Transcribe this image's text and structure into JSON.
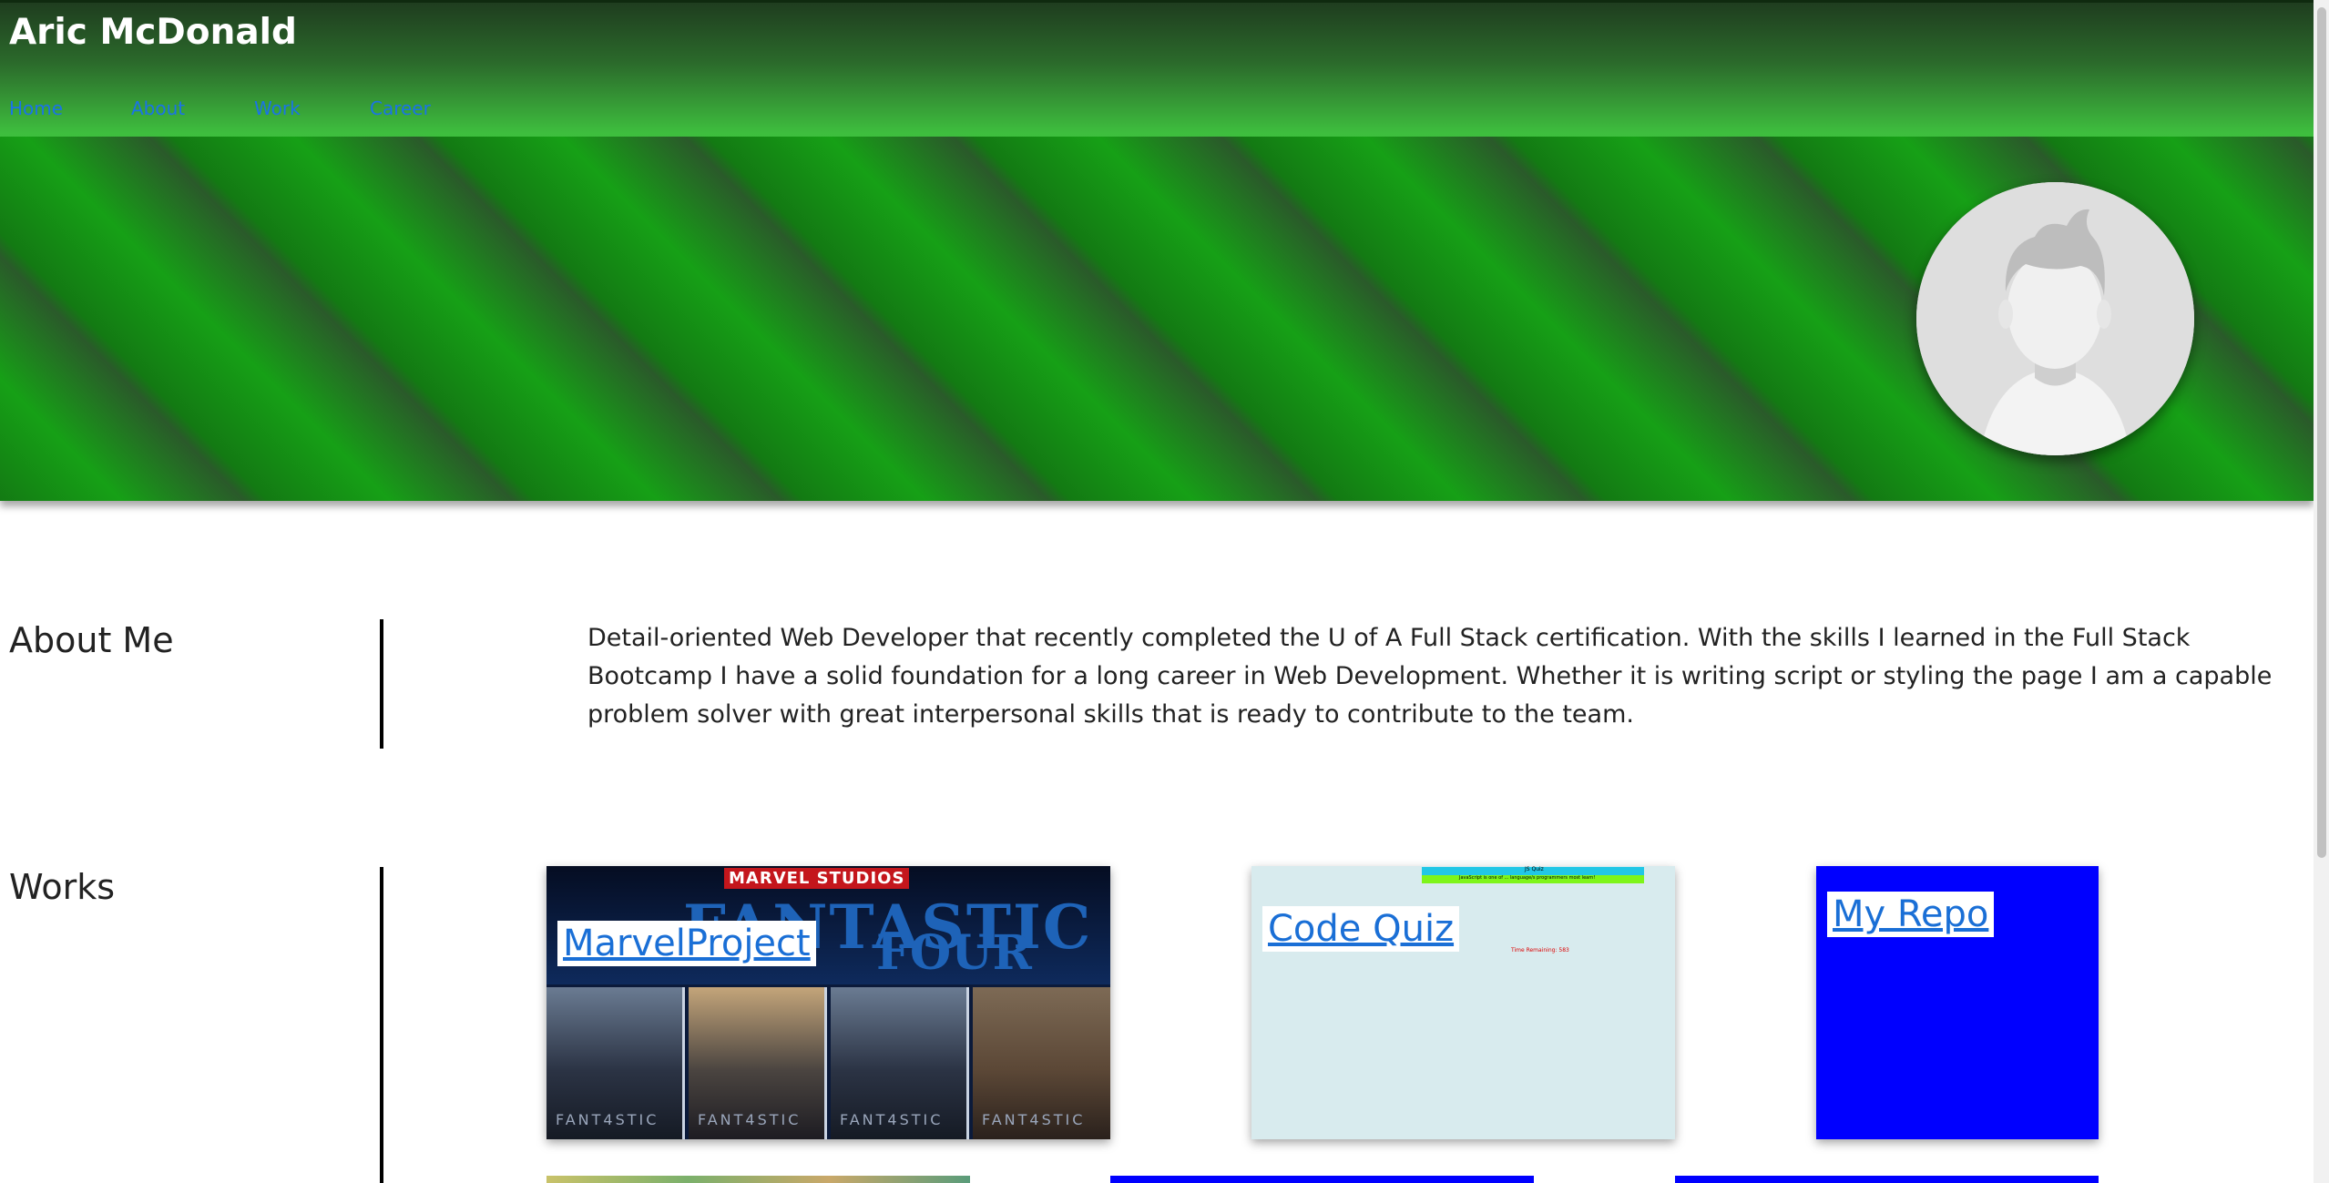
{
  "header": {
    "title": "Aric McDonald",
    "nav": [
      "Home",
      "About",
      "Work",
      "Career"
    ]
  },
  "about": {
    "heading": "About Me",
    "text": "Detail-oriented Web Developer that recently completed the U of A Full Stack certification. With the skills I learned in the Full Stack Bootcamp I have a solid foundation for a long career in Web Development. Whether it is writing script or styling the page I am a capable problem solver with great interpersonal skills that is ready to contribute to the team."
  },
  "works": {
    "heading": "Works",
    "cards": [
      {
        "label": "MarvelProject",
        "brand": "MARVEL STUDIOS",
        "poster_line1": "FANTASTIC",
        "poster_line2": "FOUR",
        "panel_glyph": "FANT4STIC"
      },
      {
        "label": "Code Quiz",
        "tiny_title": "JS Quiz",
        "tiny_question": "JavaScript is one of ... language/s programmers most learn!",
        "tiny_time": "Time Remaining: 583"
      },
      {
        "label": "My Repo"
      }
    ]
  },
  "colors": {
    "header_top": "#1f3d1f",
    "header_bottom": "#3fc23f",
    "nav_link": "#1a73e8",
    "banner_green": "#16a016",
    "repo_blue": "#0000ff",
    "quiz_bg": "#d8ebee"
  }
}
